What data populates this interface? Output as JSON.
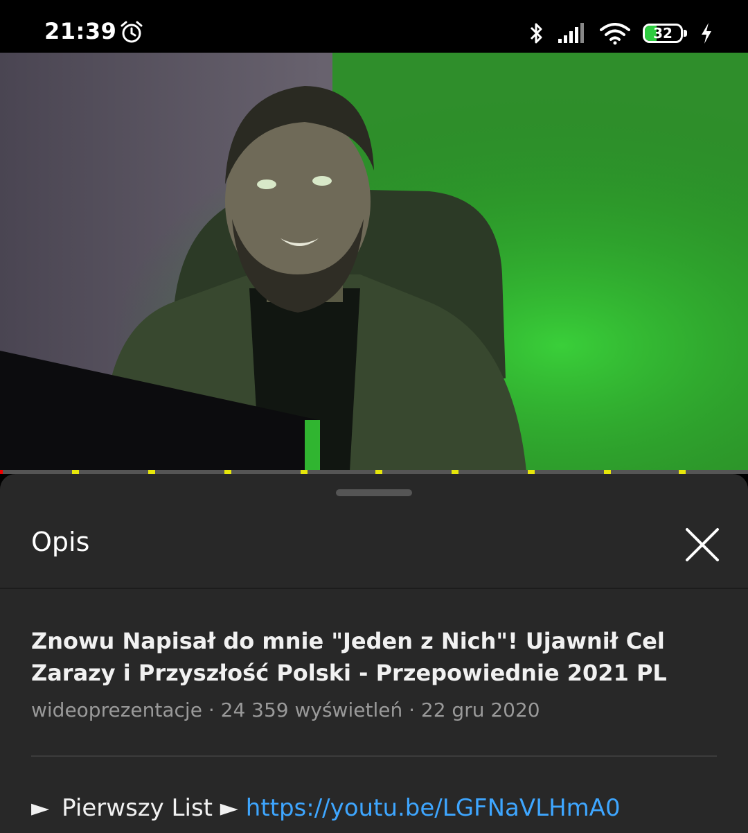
{
  "status_bar": {
    "time": "21:39",
    "battery_level": "32",
    "battery_fraction": 0.32,
    "icons": [
      "alarm-icon",
      "bluetooth-icon",
      "signal-icon",
      "wifi-icon",
      "battery-icon",
      "charging-icon"
    ]
  },
  "player": {
    "progress_fraction": 0.004
  },
  "description": {
    "title": "Opis",
    "video_title": "Znowu Napisał do mnie \"Jeden z Nich\"! Ujawnił Cel Zarazy i Przyszłość Polski - Przepowiednie 2021 PL",
    "channel": "wideoprezentacje",
    "separator": " · ",
    "views": "24 359 wyświetleń",
    "date": "22 gru 2020",
    "link_prefix_arrow": "►",
    "link_label": "Pierwszy List ►",
    "link_url": "https://youtu.be/LGFNaVLHmA0"
  },
  "colors": {
    "sheet_bg": "#282828",
    "link": "#3ea6ff",
    "meta": "#9a9a9a",
    "progress_played": "#ee0000",
    "ad_marker": "#e6e60a"
  }
}
